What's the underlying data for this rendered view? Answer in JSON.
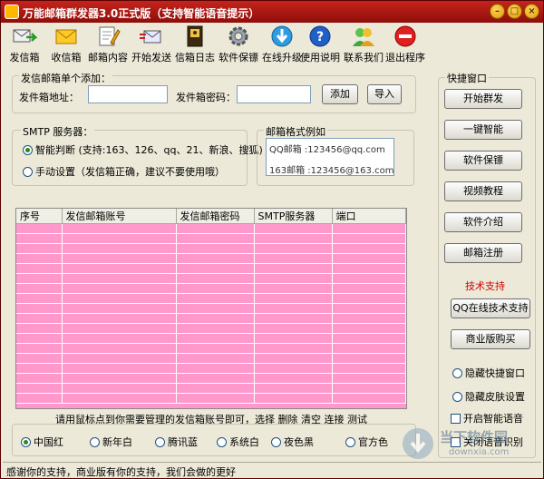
{
  "window": {
    "title": "万能邮箱群发器3.0正式版（支持智能语音提示）"
  },
  "toolbar": [
    {
      "label": "发信箱",
      "icon": "send-mailbox-icon"
    },
    {
      "label": "收信箱",
      "icon": "envelope-icon"
    },
    {
      "label": "邮箱内容",
      "icon": "edit-document-icon"
    },
    {
      "label": "开始发送",
      "icon": "mail-send-icon"
    },
    {
      "label": "信箱日志",
      "icon": "log-book-icon"
    },
    {
      "label": "软件保镖",
      "icon": "gear-icon"
    },
    {
      "label": "在线升级",
      "icon": "download-arrow-icon"
    },
    {
      "label": "使用说明",
      "icon": "help-icon"
    },
    {
      "label": "联系我们",
      "icon": "contact-people-icon"
    },
    {
      "label": "退出程序",
      "icon": "exit-icon"
    }
  ],
  "add_single": {
    "group_label": "发信邮箱单个添加：",
    "address_label": "发件箱地址：",
    "address_value": "",
    "password_label": "发件箱密码：",
    "password_value": "",
    "add_button": "添加",
    "import_button": "导入"
  },
  "smtp": {
    "group_label": "SMTP 服务器：",
    "auto_label": "智能判断 (支持:163、126、qq、21、新浪、搜狐)",
    "manual_label": "手动设置（发信箱正确，建议不要使用哦）",
    "selected": "auto"
  },
  "format_example": {
    "group_label": "邮箱格式例如",
    "lines": [
      "QQ邮箱 :123456@qq.com",
      "163邮箱 :123456@163.com"
    ]
  },
  "grid": {
    "headers": [
      "序号",
      "发信邮箱账号",
      "发信邮箱密码",
      "SMTP服务器",
      "端口"
    ],
    "rows": 18,
    "row_color": "#ff99cc"
  },
  "hint": "请用鼠标点到你需要管理的发信箱账号即可，选择 删除 清空 连接 测试",
  "themes": {
    "selected": "中国红",
    "options": [
      "中国红",
      "新年白",
      "腾讯蓝",
      "系统白",
      "夜色黑",
      "官方色"
    ]
  },
  "quick": {
    "group_label": "快捷窗口",
    "buttons": [
      "开始群发",
      "一键智能",
      "软件保镖",
      "视频教程",
      "软件介绍",
      "邮箱注册"
    ],
    "tech_label": "技术支持",
    "qq_button": "QQ在线技术支持",
    "commercial_button": "商业版购买",
    "hide_quick": "隐藏快捷窗口",
    "hide_skin": "隐藏皮肤设置",
    "voice_on": "开启智能语音",
    "voice_off": "关闭语音识别"
  },
  "status": "感谢你的支持，商业版有你的支持，我们会做的更好",
  "watermark": {
    "line1": "当下软件园",
    "line2": "downxia.com"
  },
  "colors": {
    "title_bar": "#b0160f",
    "grid_row": "#ff99cc",
    "tech_support": "#d00000"
  }
}
